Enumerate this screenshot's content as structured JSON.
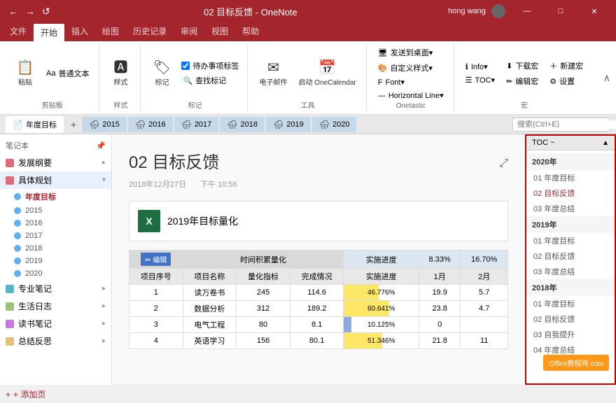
{
  "titlebar": {
    "title": "02 目标反馈 - OneNote",
    "user": "hong wang",
    "quickaccess": [
      "←",
      "→",
      "↺"
    ]
  },
  "ribbon": {
    "tabs": [
      "文件",
      "开始",
      "插入",
      "绘图",
      "历史记录",
      "审阅",
      "视图",
      "帮助"
    ],
    "activeTab": "开始",
    "groups": {
      "clipboard": {
        "label": "剪贴板",
        "items": [
          "粘贴",
          "普通文本"
        ]
      },
      "styles": {
        "label": "样式",
        "items": [
          "样式"
        ]
      },
      "tag": {
        "label": "标记",
        "items": [
          "标记",
          "待办事项标签",
          "查找标记"
        ]
      },
      "email": {
        "label": "工具",
        "items": [
          "电子邮件",
          "启动 OneCalendar"
        ]
      },
      "onetastic": {
        "label": "Onetastic",
        "items": [
          "发送到桌面",
          "自定义样式",
          "Font",
          "Horizontal Line"
        ]
      },
      "hong": {
        "label": "宏",
        "items": [
          "Info",
          "TOC",
          "下载宏",
          "编辑宏",
          "新建宏",
          "设置"
        ]
      }
    }
  },
  "tabbar": {
    "tabs": [
      "年度目标",
      "2015",
      "2016",
      "2017",
      "2018",
      "2019",
      "2020"
    ],
    "activeTab": "年度目标",
    "searchPlaceholder": "搜索(Ctrl+E)"
  },
  "notebook": {
    "title": "笔记本",
    "items": [
      {
        "label": "发展纲要",
        "color": "#e06c75",
        "expanded": false
      },
      {
        "label": "具体规划",
        "color": "#e06c75",
        "expanded": true,
        "active": true,
        "sections": [
          {
            "label": "年度目标",
            "color": "#61afef",
            "active": true
          },
          {
            "label": "2015",
            "color": "#61afef"
          },
          {
            "label": "2016",
            "color": "#61afef"
          },
          {
            "label": "2017",
            "color": "#61afef"
          },
          {
            "label": "2018",
            "color": "#61afef"
          },
          {
            "label": "2019",
            "color": "#61afef"
          },
          {
            "label": "2020",
            "color": "#61afef"
          }
        ]
      },
      {
        "label": "专业笔记",
        "color": "#56b6c2",
        "expanded": false
      },
      {
        "label": "生活日志",
        "color": "#98c379",
        "expanded": false
      },
      {
        "label": "读书笔记",
        "color": "#c678dd",
        "expanded": false
      },
      {
        "label": "总结反思",
        "color": "#e5c07b",
        "expanded": false
      }
    ]
  },
  "page": {
    "title": "02 目标反馈",
    "date": "2018年12月27日",
    "time": "下午 10:56",
    "embedded": "2019年目标量化",
    "expandBtn": "⤢"
  },
  "table": {
    "headers1": [
      "编辑",
      "时间积累量化",
      "",
      "8.33%",
      "16.70%"
    ],
    "headers2": [
      "项目序号",
      "项目名称",
      "量化指标",
      "完成情况",
      "实施进度",
      "1月",
      "2月"
    ],
    "rows": [
      {
        "id": "1",
        "name": "读万卷书",
        "target": "245",
        "done": "114.6",
        "progress": "46.776%",
        "pct": 46.7,
        "m1": "19.9",
        "m2": "5.7"
      },
      {
        "id": "2",
        "name": "数据分析",
        "target": "312",
        "done": "189.2",
        "progress": "60.641%",
        "pct": 60.6,
        "m1": "23.8",
        "m2": "4.7"
      },
      {
        "id": "3",
        "name": "电气工程",
        "target": "80",
        "done": "8.1",
        "progress": "10.125%",
        "pct": 10.1,
        "m1": "0",
        "m2": ""
      },
      {
        "id": "4",
        "name": "英语学习",
        "target": "156",
        "done": "80.1",
        "progress": "51.346%",
        "pct": 51.3,
        "m1": "21.8",
        "m2": "11"
      }
    ]
  },
  "toc": {
    "title": "TOC ~",
    "scrollUp": "▲",
    "sections": [
      {
        "year": "2020年",
        "pages": [
          "01 年度目标",
          "02 目标反馈",
          "03 年度总结"
        ]
      },
      {
        "year": "2019年",
        "pages": [
          "01 年度目标",
          "02 目标反馈",
          "03 年度总结"
        ]
      },
      {
        "year": "2018年",
        "pages": [
          "01 年度目标",
          "02 目标反馈",
          "03 自我提升",
          "04 年度总结"
        ]
      }
    ],
    "activePage": "02 目标反馈"
  },
  "addPage": "+ 添加页",
  "watermark": "Office教程网.com",
  "windowControls": [
    "—",
    "□",
    "✕"
  ]
}
